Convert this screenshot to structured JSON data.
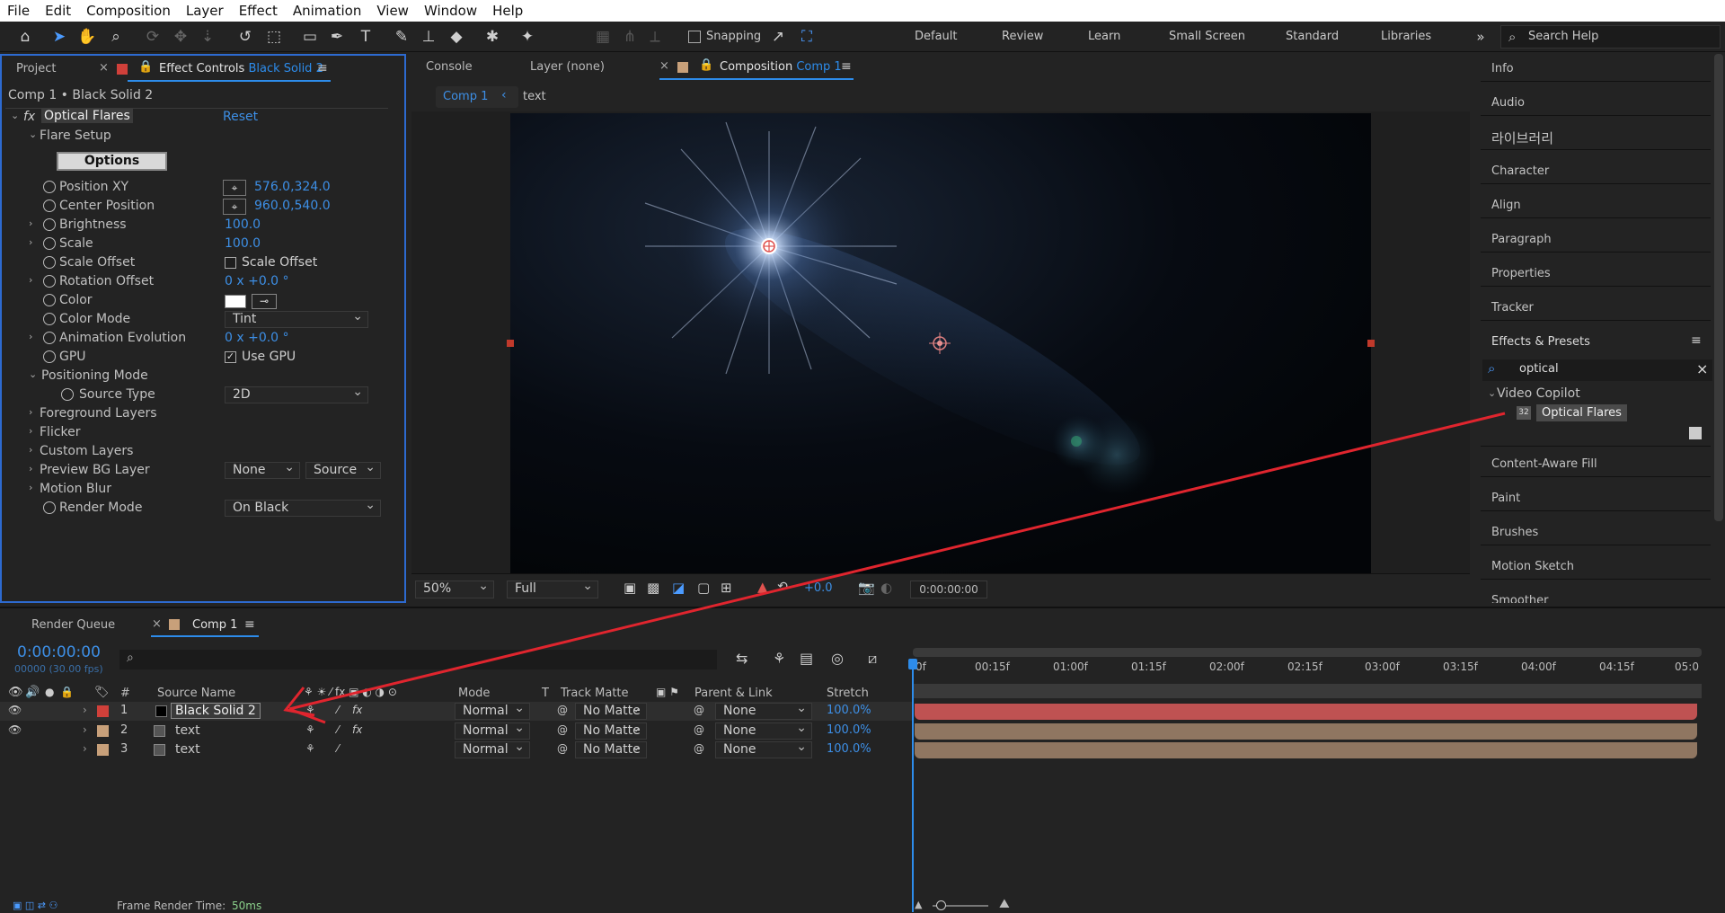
{
  "menu": [
    "File",
    "Edit",
    "Composition",
    "Layer",
    "Effect",
    "Animation",
    "View",
    "Window",
    "Help"
  ],
  "toolbar": {
    "snapping_label": "Snapping",
    "workspaces": [
      "Default",
      "Review",
      "Learn",
      "Small Screen",
      "Standard",
      "Libraries"
    ],
    "search_placeholder": "Search Help"
  },
  "effect_controls": {
    "tab_project": "Project",
    "tab_effect_controls": "Effect Controls",
    "tab_effect_controls_layer": "Black Solid 2",
    "breadcrumb": "Comp 1 • Black Solid 2",
    "effect_name": "Optical Flares",
    "reset_label": "Reset",
    "flare_setup": "Flare Setup",
    "options_button": "Options",
    "position_xy": {
      "label": "Position XY",
      "value": "576.0,324.0"
    },
    "center_position": {
      "label": "Center Position",
      "value": "960.0,540.0"
    },
    "brightness": {
      "label": "Brightness",
      "value": "100.0"
    },
    "scale": {
      "label": "Scale",
      "value": "100.0"
    },
    "scale_offset": {
      "label": "Scale Offset",
      "checkbox_label": "Scale Offset"
    },
    "rotation_offset": {
      "label": "Rotation Offset",
      "value": "0 x +0.0 °"
    },
    "color": {
      "label": "Color",
      "swatch": "#ffffff"
    },
    "color_mode": {
      "label": "Color Mode",
      "value": "Tint"
    },
    "animation_evolution": {
      "label": "Animation Evolution",
      "value": "0 x +0.0 °"
    },
    "gpu": {
      "label": "GPU",
      "checkbox_label": "Use GPU"
    },
    "positioning_mode": "Positioning Mode",
    "source_type": {
      "label": "Source Type",
      "value": "2D"
    },
    "foreground_layers": "Foreground Layers",
    "flicker": "Flicker",
    "custom_layers": "Custom Layers",
    "preview_bg_layer": {
      "label": "Preview BG Layer",
      "value1": "None",
      "value2": "Source"
    },
    "motion_blur": "Motion Blur",
    "render_mode": {
      "label": "Render Mode",
      "value": "On Black"
    }
  },
  "comp_panel": {
    "tab_console": "Console",
    "tab_layer": "Layer (none)",
    "tab_composition": "Composition",
    "tab_composition_name": "Comp 1",
    "crumb_comp": "Comp 1",
    "crumb_text": "text",
    "zoom": "50%",
    "resolution": "Full",
    "exposure": "+0.0",
    "timecode": "0:00:00:00"
  },
  "right_panel": {
    "items_top": [
      "Info",
      "Audio",
      "라이브러리",
      "Character",
      "Align",
      "Paragraph",
      "Properties",
      "Tracker"
    ],
    "effects_presets_title": "Effects & Presets",
    "search_value": "optical",
    "folder": "Video Copilot",
    "result": "Optical Flares",
    "result_badge": "32",
    "items_bottom": [
      "Content-Aware Fill",
      "Paint",
      "Brushes",
      "Motion Sketch",
      "Smoother"
    ]
  },
  "timeline": {
    "tab_render_queue": "Render Queue",
    "tab_comp": "Comp 1",
    "timecode": "0:00:00:00",
    "fps": "00000 (30.00 fps)",
    "headers": {
      "num": "#",
      "source_name": "Source Name",
      "mode": "Mode",
      "t": "T",
      "track_matte": "Track Matte",
      "parent_link": "Parent & Link",
      "stretch": "Stretch"
    },
    "ruler": [
      "0f",
      "00:15f",
      "01:00f",
      "01:15f",
      "02:00f",
      "02:15f",
      "03:00f",
      "03:15f",
      "04:00f",
      "04:15f",
      "05:0"
    ],
    "layers": [
      {
        "num": "1",
        "name": "Black Solid 2",
        "mode": "Normal",
        "matte": "No Matte",
        "parent": "None",
        "stretch": "100.0%",
        "label_color": "#d0403a",
        "bar_color": "#bf5252",
        "visible": true
      },
      {
        "num": "2",
        "name": "text",
        "mode": "Normal",
        "matte": "No Matte",
        "parent": "None",
        "stretch": "100.0%",
        "label_color": "#c8a07a",
        "bar_color": "#8f7661",
        "visible": true
      },
      {
        "num": "3",
        "name": "text",
        "mode": "Normal",
        "matte": "No Matte",
        "parent": "None",
        "stretch": "100.0%",
        "label_color": "#c8a07a",
        "bar_color": "#8f7661",
        "visible": false
      }
    ],
    "frame_render_label": "Frame Render Time:",
    "frame_render_value": "50ms"
  },
  "colors": {
    "accent": "#2d8ceb",
    "arrow": "#e0252e",
    "panel_focus": "#2d6ad0"
  }
}
